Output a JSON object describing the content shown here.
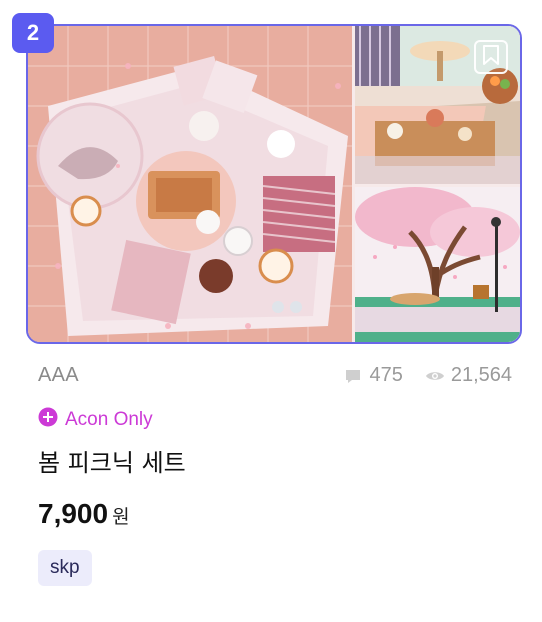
{
  "product": {
    "rank": "2",
    "author": "AAA",
    "comments": "475",
    "views": "21,564",
    "badge": "Acon Only",
    "title": "봄 피크닉 세트",
    "price": "7,900",
    "currency": "원",
    "tags": [
      "skp"
    ]
  },
  "icons": {
    "bookmark": "bookmark-icon",
    "comment": "comment-icon",
    "view": "eye-icon",
    "acon": "plus-circle-icon"
  },
  "colors": {
    "accent": "#5b5bf0",
    "acon": "#cc3ad6",
    "muted": "#9a9a9a",
    "tag_bg": "#ececfb"
  }
}
